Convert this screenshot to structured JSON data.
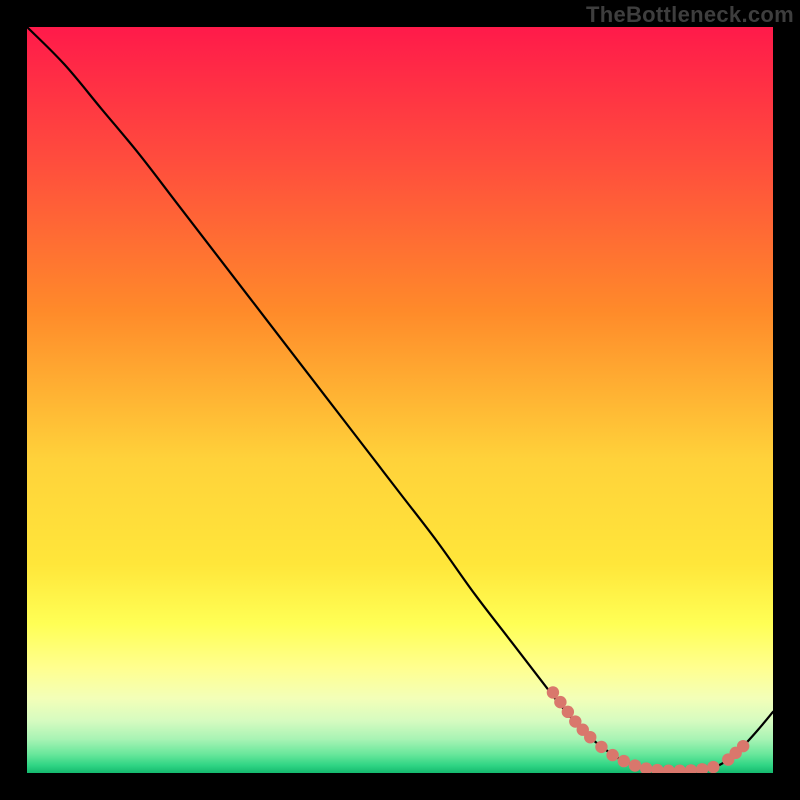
{
  "watermark": "TheBottleneck.com",
  "colors": {
    "black": "#000000",
    "curve": "#000000",
    "dot": "#d9776c",
    "grad_top": "#ff1a4a",
    "grad_mid_upper": "#ff8a2a",
    "grad_mid": "#ffe63a",
    "grad_low_yellow": "#ffff70",
    "grad_low_light": "#f6ffb0",
    "grad_green1": "#b8f7bc",
    "grad_green2": "#6dea9a",
    "grad_green3": "#2ed583",
    "grad_green4": "#14b96e"
  },
  "chart_data": {
    "type": "line",
    "title": "",
    "xlabel": "",
    "ylabel": "",
    "xlim": [
      0,
      100
    ],
    "ylim": [
      0,
      100
    ],
    "series": [
      {
        "name": "bottleneck-curve",
        "x": [
          0,
          5,
          10,
          15,
          20,
          25,
          30,
          35,
          40,
          45,
          50,
          55,
          60,
          65,
          70,
          72,
          75,
          78,
          80,
          82,
          84,
          86,
          88,
          90,
          92,
          94,
          96,
          98,
          100
        ],
        "y": [
          100,
          95,
          89,
          83,
          76.5,
          70,
          63.5,
          57,
          50.5,
          44,
          37.5,
          31,
          24,
          17.5,
          11,
          8.5,
          5.2,
          2.8,
          1.6,
          0.9,
          0.5,
          0.35,
          0.3,
          0.35,
          0.7,
          1.8,
          3.6,
          5.8,
          8.2
        ]
      }
    ],
    "scatter": [
      {
        "name": "flat-region-dots",
        "points": [
          {
            "x": 70.5,
            "y": 10.8
          },
          {
            "x": 71.5,
            "y": 9.5
          },
          {
            "x": 72.5,
            "y": 8.2
          },
          {
            "x": 73.5,
            "y": 6.9
          },
          {
            "x": 74.5,
            "y": 5.8
          },
          {
            "x": 75.5,
            "y": 4.8
          },
          {
            "x": 77.0,
            "y": 3.5
          },
          {
            "x": 78.5,
            "y": 2.4
          },
          {
            "x": 80.0,
            "y": 1.6
          },
          {
            "x": 81.5,
            "y": 1.0
          },
          {
            "x": 83.0,
            "y": 0.6
          },
          {
            "x": 84.5,
            "y": 0.4
          },
          {
            "x": 86.0,
            "y": 0.3
          },
          {
            "x": 87.5,
            "y": 0.3
          },
          {
            "x": 89.0,
            "y": 0.35
          },
          {
            "x": 90.5,
            "y": 0.5
          },
          {
            "x": 92.0,
            "y": 0.8
          },
          {
            "x": 94.0,
            "y": 1.8
          },
          {
            "x": 95.0,
            "y": 2.7
          },
          {
            "x": 96.0,
            "y": 3.6
          }
        ]
      }
    ]
  }
}
